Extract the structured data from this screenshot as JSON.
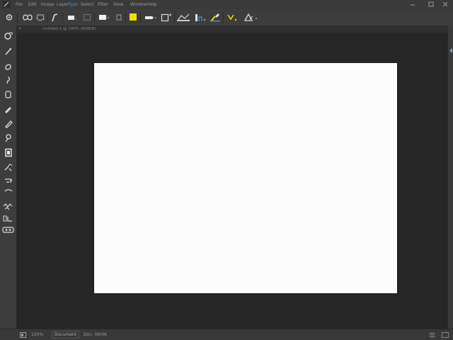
{
  "menubar": {
    "items": [
      "File",
      "Edit",
      "Image",
      "Layer",
      "Type",
      "Select",
      "Filter",
      "View",
      "Window",
      "Help"
    ],
    "highlight_color": "#4a90d9"
  },
  "optionsbar": {
    "tools": [
      "move-icon",
      "lasso-icon",
      "polygon-icon",
      "pen-icon",
      "rectangle-icon",
      "rounded-rect-icon",
      "fill-color-swatch",
      "stroke-icon",
      "text-icon",
      "align-icon",
      "chart-icon",
      "warp-icon",
      "brush-icon",
      "triangle-icon"
    ],
    "fill_color": "#f2e000"
  },
  "tabrow": {
    "doc_label": "Untitled-1 @ 100% (RGB/8)"
  },
  "tools": [
    "move-tool-icon",
    "lasso-tool-icon",
    "quick-select-icon",
    "crop-icon",
    "eyedropper-icon",
    "healing-brush-icon",
    "brush-tool-icon",
    "stamp-icon",
    "history-brush-icon",
    "eraser-icon",
    "gradient-icon",
    "blur-icon",
    "dodge-icon",
    "pen-tool-icon",
    "type-tool-icon",
    "shape-tool-icon"
  ],
  "canvas": {
    "background": "#fbfbfb"
  },
  "statusbar": {
    "zoom": "100%",
    "doc_button": "Document",
    "info": "Doc: 0K/0K"
  }
}
